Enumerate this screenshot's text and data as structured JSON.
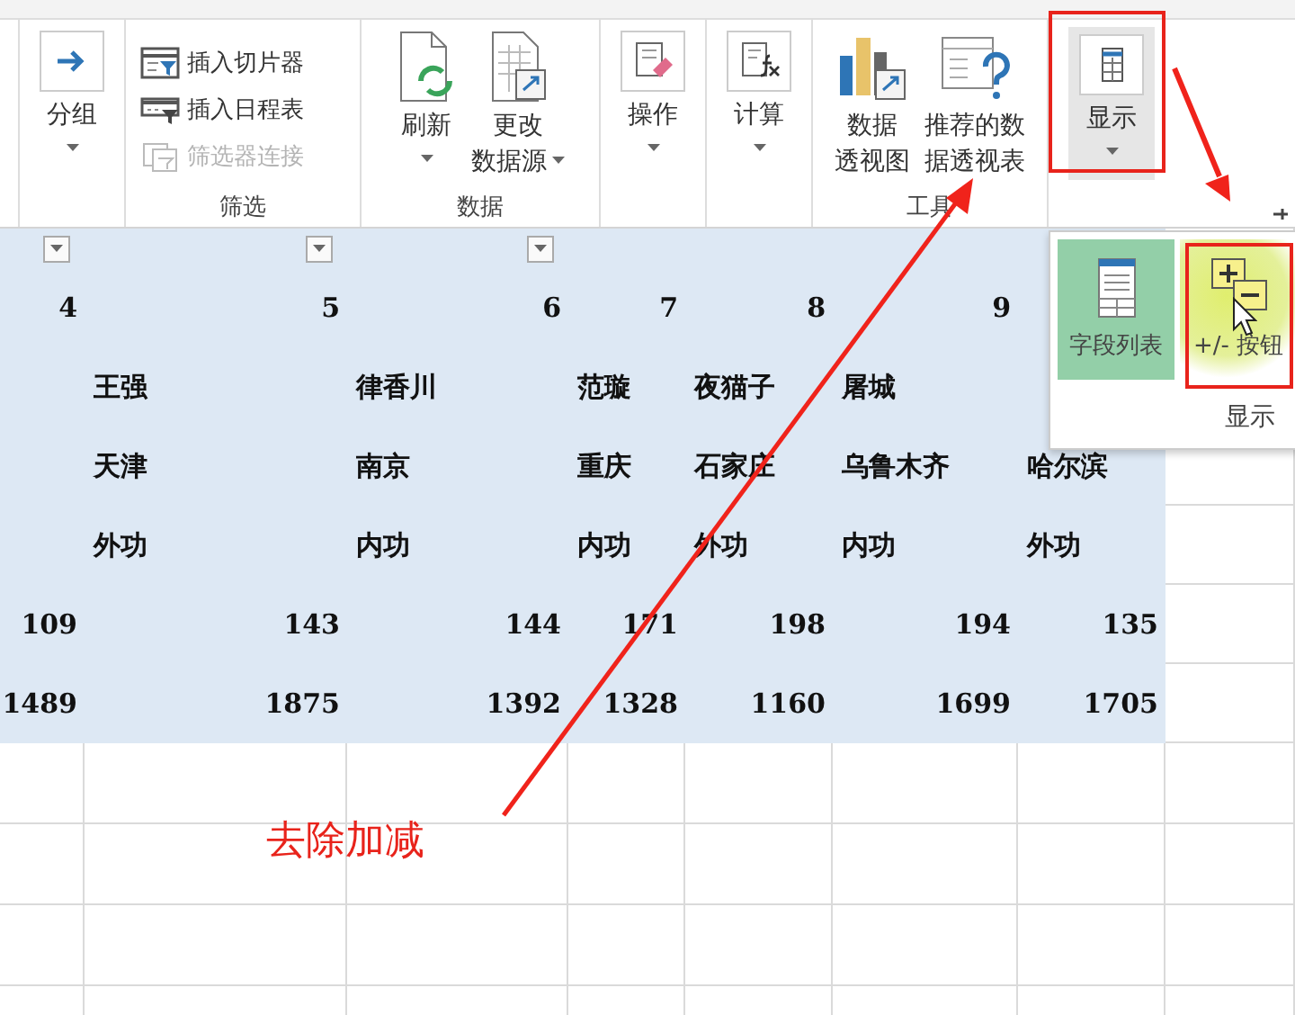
{
  "ribbon": {
    "group_button": {
      "label": "分组",
      "dropdown": true
    },
    "filter_group": {
      "label": "筛选",
      "items": [
        {
          "label": "插入切片器",
          "disabled": false
        },
        {
          "label": "插入日程表",
          "disabled": false
        },
        {
          "label": "筛选器连接",
          "disabled": true
        }
      ]
    },
    "data_group": {
      "label": "数据",
      "buttons": [
        {
          "lines": [
            "刷新"
          ],
          "dropdown": true
        },
        {
          "lines": [
            "更改",
            "数据源"
          ],
          "dropdown": true
        }
      ]
    },
    "action_button": {
      "label": "操作",
      "dropdown": true
    },
    "calc_button": {
      "label": "计算",
      "dropdown": true
    },
    "tools_group": {
      "label": "工具",
      "buttons": [
        {
          "lines": [
            "数据",
            "透视图"
          ]
        },
        {
          "lines": [
            "推荐的数",
            "据透视表"
          ]
        }
      ]
    },
    "show_button": {
      "label": "显示",
      "dropdown": true,
      "pressed": true
    }
  },
  "pivot": {
    "header": [
      {
        "filter": true
      },
      {
        "filter": true
      },
      {
        "filter": true
      }
    ],
    "rows": [
      {
        "kind": "number",
        "cells": [
          "4",
          "5",
          "6",
          "7",
          "8",
          "9",
          null
        ]
      },
      {
        "kind": "text",
        "cells": [
          null,
          "王强",
          "律香川",
          "范璇",
          "夜猫子",
          "屠城",
          null
        ]
      },
      {
        "kind": "text",
        "cells": [
          null,
          "天津",
          "南京",
          "重庆",
          "石家庄",
          "乌鲁木齐",
          "哈尔滨"
        ]
      },
      {
        "kind": "text",
        "cells": [
          null,
          "外功",
          "内功",
          "内功",
          "外功",
          "内功",
          "外功"
        ]
      },
      {
        "kind": "number",
        "cells": [
          "109",
          "143",
          "144",
          "171",
          "198",
          "194",
          "135"
        ]
      },
      {
        "kind": "number",
        "cells": [
          "1489",
          "1875",
          "1392",
          "1328",
          "1160",
          "1699",
          "1705"
        ]
      }
    ]
  },
  "show_popup": {
    "label": "显示",
    "items": [
      {
        "label": "字段列表",
        "selected": true,
        "highlighted": false
      },
      {
        "label": "+/- 按钮",
        "selected": false,
        "highlighted": true
      }
    ]
  },
  "annotation": {
    "text": "去除加减"
  }
}
